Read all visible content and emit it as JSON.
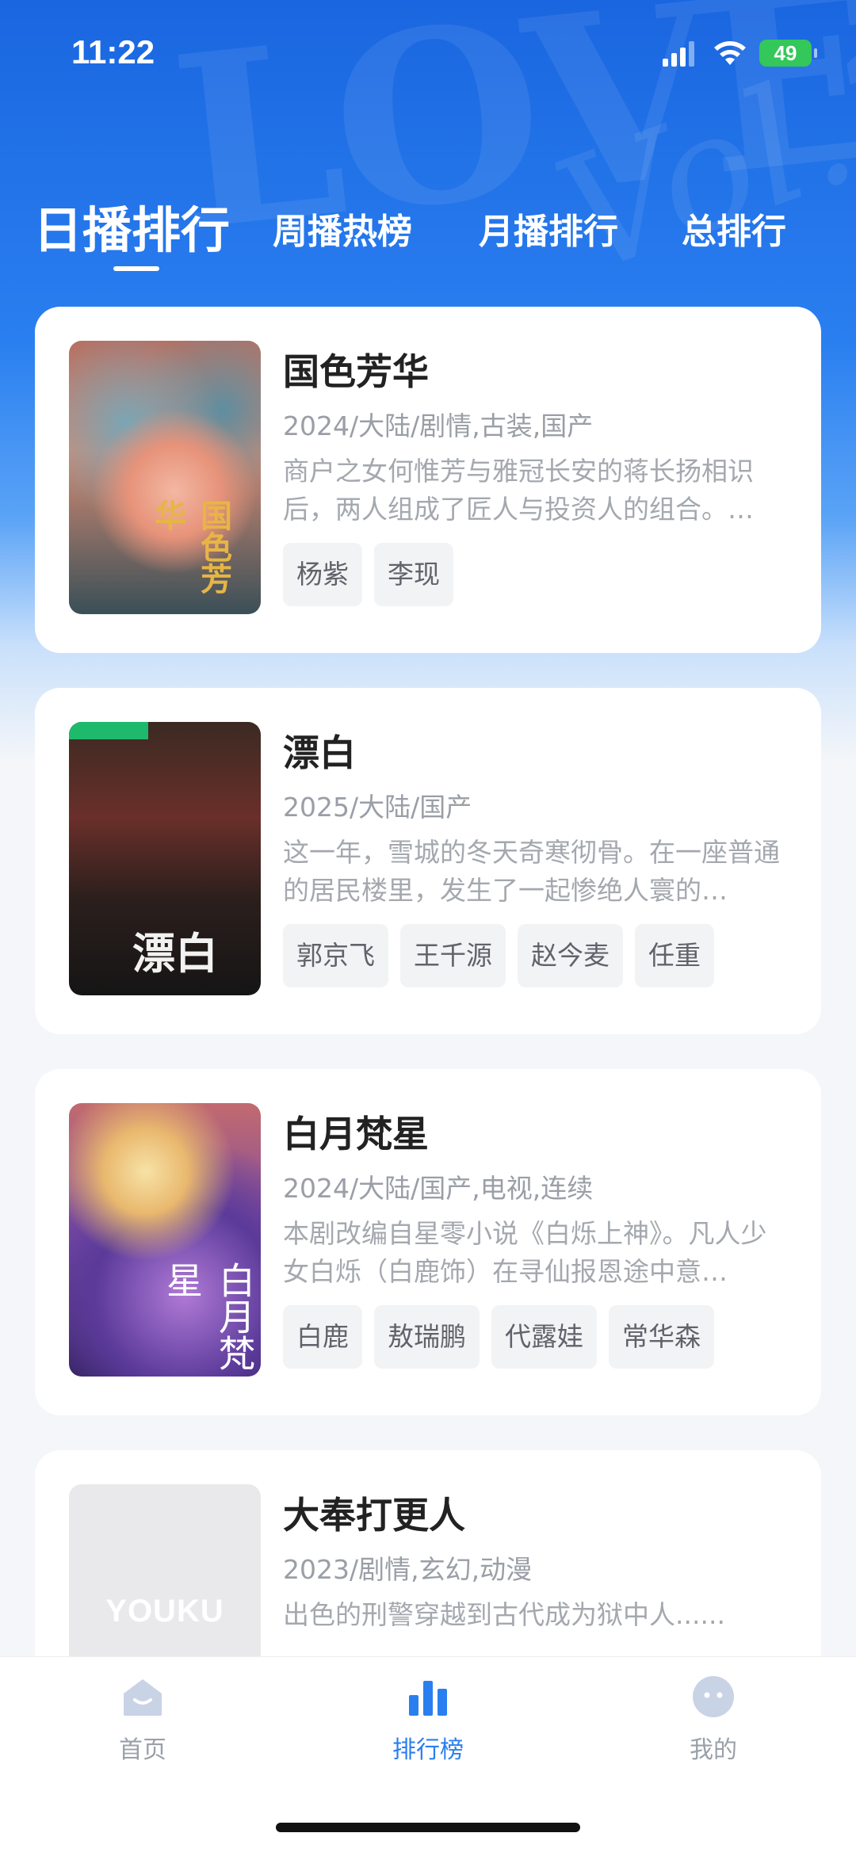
{
  "status_bar": {
    "time": "11:22",
    "battery": "49"
  },
  "tabs": [
    {
      "label": "日播排行",
      "active": true
    },
    {
      "label": "周播热榜",
      "active": false
    },
    {
      "label": "月播排行",
      "active": false
    },
    {
      "label": "总排行",
      "active": false
    }
  ],
  "shows": [
    {
      "title": "国色芳华",
      "meta": "2024/大陆/剧情,古装,国产",
      "desc": "商户之女何惟芳与雅冠长安的蒋长扬相识后，两人组成了匠人与投资人的组合。…",
      "tags": [
        "杨紫",
        "李现"
      ],
      "poster_text": "国色芳华"
    },
    {
      "title": "漂白",
      "meta": "2025/大陆/国产",
      "desc": "这一年，雪城的冬天奇寒彻骨。在一座普通的居民楼里，发生了一起惨绝人寰的…",
      "tags": [
        "郭京飞",
        "王千源",
        "赵今麦",
        "任重"
      ],
      "poster_text": "漂白"
    },
    {
      "title": "白月梵星",
      "meta": "2024/大陆/国产,电视,连续",
      "desc": "本剧改编自星零小说《白烁上神》。凡人少女白烁（白鹿饰）在寻仙报恩途中意…",
      "tags": [
        "白鹿",
        "敖瑞鹏",
        "代露娃",
        "常华森"
      ],
      "poster_text": "白月梵星"
    },
    {
      "title": "大奉打更人",
      "meta": "2023/剧情,玄幻,动漫",
      "desc": "出色的刑警穿越到古代成为狱中人......",
      "tags": [],
      "poster_text": "YOUKU"
    }
  ],
  "bottom_nav": [
    {
      "label": "首页",
      "icon": "home-icon",
      "active": false
    },
    {
      "label": "排行榜",
      "icon": "ranking-icon",
      "active": true
    },
    {
      "label": "我的",
      "icon": "profile-icon",
      "active": false
    }
  ],
  "colors": {
    "accent": "#2a7ff0",
    "hero": "#1a66e0",
    "battery": "#34c759"
  }
}
